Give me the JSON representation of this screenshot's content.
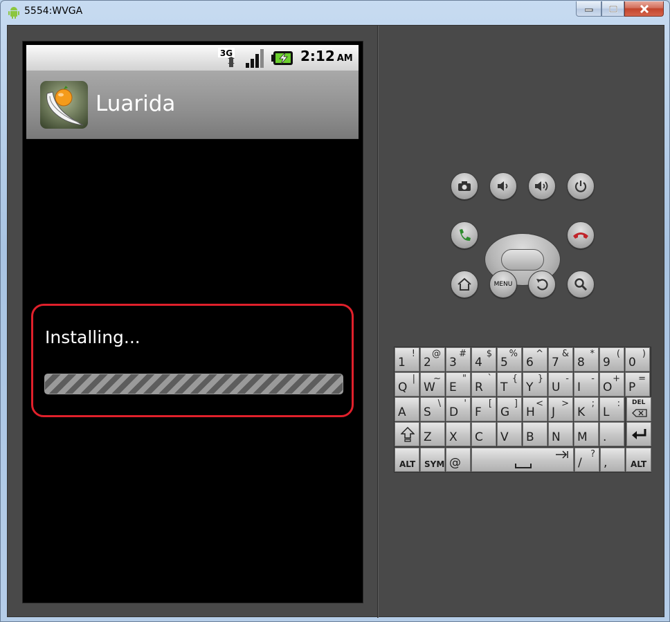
{
  "window": {
    "title": "5554:WVGA"
  },
  "status": {
    "network": "3G",
    "time": "2:12",
    "ampm": "AM"
  },
  "app": {
    "title": "Luarida"
  },
  "dialog": {
    "message": "Installing...",
    "progress_indeterminate": true
  },
  "keyboard": {
    "row1": [
      {
        "p": "1",
        "s": "!"
      },
      {
        "p": "2",
        "s": "@"
      },
      {
        "p": "3",
        "s": "#"
      },
      {
        "p": "4",
        "s": "$"
      },
      {
        "p": "5",
        "s": "%"
      },
      {
        "p": "6",
        "s": "^"
      },
      {
        "p": "7",
        "s": "&"
      },
      {
        "p": "8",
        "s": "*"
      },
      {
        "p": "9",
        "s": "("
      },
      {
        "p": "0",
        "s": ")"
      }
    ],
    "row2": [
      {
        "p": "Q",
        "s": "|"
      },
      {
        "p": "W",
        "s": "~"
      },
      {
        "p": "E",
        "s": "\""
      },
      {
        "p": "R",
        "s": "`"
      },
      {
        "p": "T",
        "s": "{"
      },
      {
        "p": "Y",
        "s": "}"
      },
      {
        "p": "U",
        "s": "-"
      },
      {
        "p": "I",
        "s": "-"
      },
      {
        "p": "O",
        "s": "+"
      },
      {
        "p": "P",
        "s": "="
      }
    ],
    "row3": [
      {
        "p": "A",
        "s": ""
      },
      {
        "p": "S",
        "s": "\\"
      },
      {
        "p": "D",
        "s": "'"
      },
      {
        "p": "F",
        "s": "["
      },
      {
        "p": "G",
        "s": "]"
      },
      {
        "p": "H",
        "s": "<"
      },
      {
        "p": "J",
        "s": ">"
      },
      {
        "p": "K",
        "s": ";"
      },
      {
        "p": "L",
        "s": ":"
      }
    ],
    "del_label": "DEL",
    "row4": [
      {
        "p": "Z",
        "s": ""
      },
      {
        "p": "X",
        "s": ""
      },
      {
        "p": "C",
        "s": ""
      },
      {
        "p": "V",
        "s": ""
      },
      {
        "p": "B",
        "s": ""
      },
      {
        "p": "N",
        "s": ""
      },
      {
        "p": "M",
        "s": ""
      },
      {
        "p": ".",
        "s": ""
      }
    ],
    "alt_label": "ALT",
    "sym_label": "SYM",
    "at_label": "@",
    "slash_label": "/",
    "question_label": "?",
    "comma_label": ","
  },
  "controls": {
    "menu_label": "MENU"
  }
}
